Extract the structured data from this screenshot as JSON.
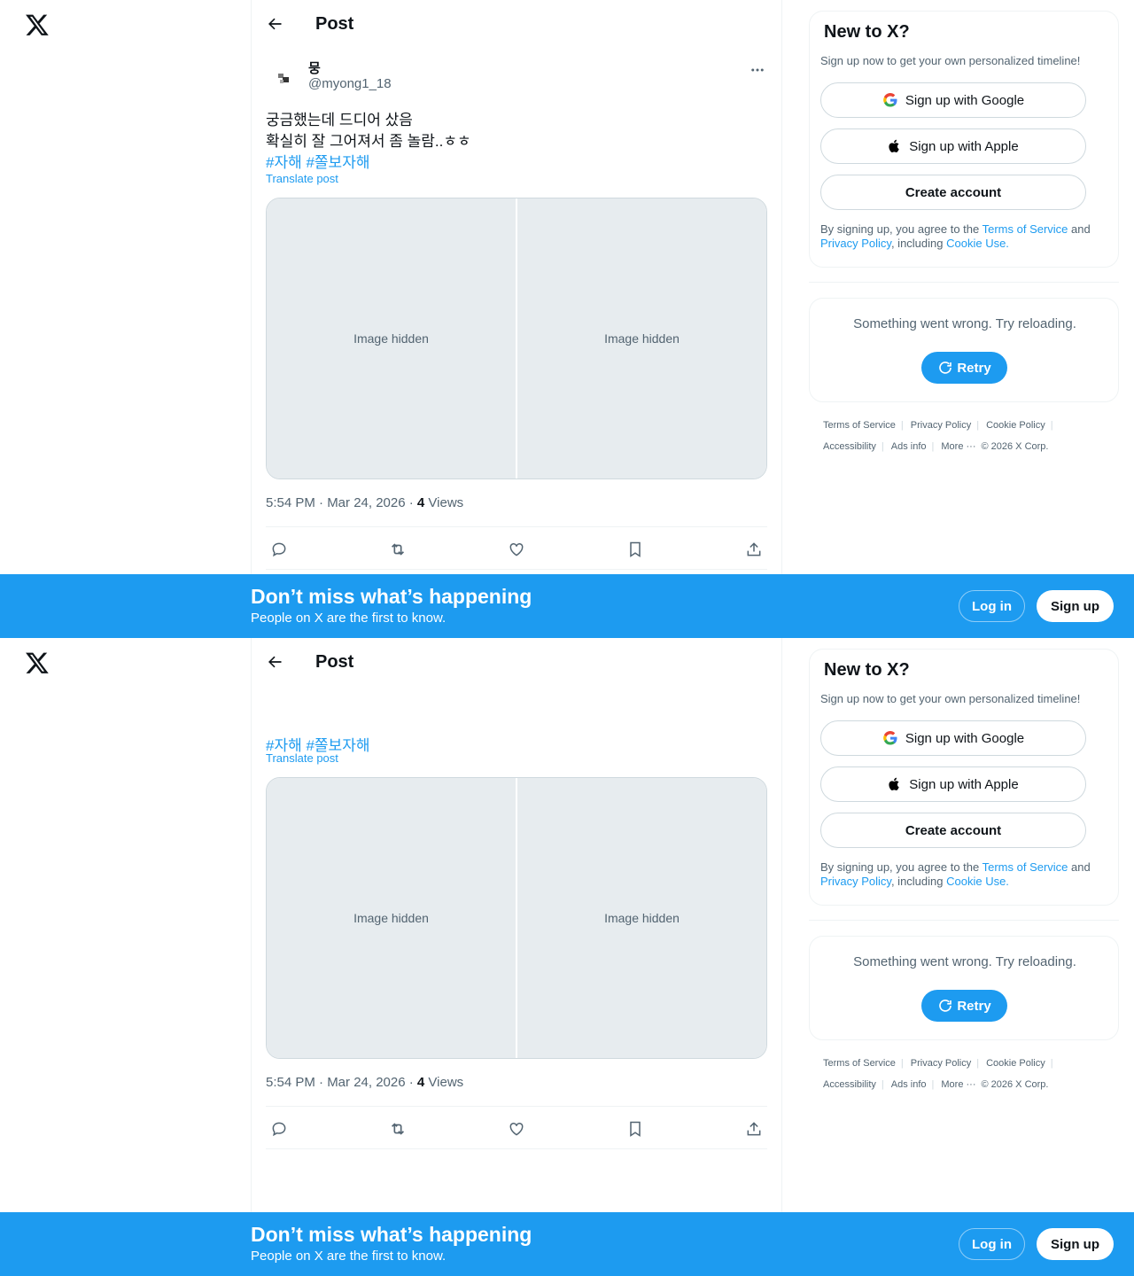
{
  "header": {
    "title": "Post"
  },
  "post": {
    "display_name": "뭉",
    "handle": "@myong1_18",
    "text_line1": "궁금했는데 드디어 샀음",
    "text_line2": "확실히 잘 그어져서 좀 놀람..ㅎㅎ",
    "hashtags": "#자해 #쫄보자해",
    "translate": "Translate post",
    "image_placeholder": "Image hidden",
    "timestamp": "5:54 PM · Mar 24, 2026 · ",
    "views_count": "4",
    "views_label": " Views"
  },
  "signup_card": {
    "title": "New to X?",
    "subtitle": "Sign up now to get your own personalized timeline!",
    "google": "Sign up with Google",
    "apple": "Sign up with Apple",
    "create": "Create account",
    "legal_1": "By signing up, you agree to the ",
    "tos": "Terms of Service",
    "legal_2": " and ",
    "privacy": "Privacy Policy",
    "legal_3": ", including ",
    "cookie": "Cookie Use."
  },
  "error_card": {
    "message": "Something went wrong. Try reloading.",
    "retry": "Retry"
  },
  "footer": {
    "terms": "Terms of Service",
    "privacy": "Privacy Policy",
    "cookie": "Cookie Policy",
    "accessibility": "Accessibility",
    "ads": "Ads info",
    "more": "More ···",
    "copyright": "© 2026 X Corp."
  },
  "banner": {
    "title": "Don’t miss what’s happening",
    "subtitle": "People on X are the first to know.",
    "login": "Log in",
    "signup": "Sign up"
  },
  "colors": {
    "accent": "#1d9bf0",
    "text": "#0f1419",
    "muted": "#536471"
  }
}
